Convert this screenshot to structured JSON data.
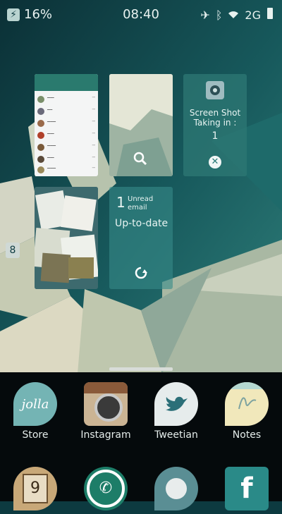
{
  "status_bar": {
    "battery": "16%",
    "time": "08:40",
    "network": "2G"
  },
  "covers": {
    "screenshot": {
      "app_name": "Screen Shot",
      "subtitle": "Taking in :",
      "countdown": "1"
    },
    "email": {
      "count": "1",
      "unread_label": "Unread email",
      "status": "Up-to-date"
    }
  },
  "apps": [
    {
      "label": "Store"
    },
    {
      "label": "Instagram"
    },
    {
      "label": "Tweetian"
    },
    {
      "label": "Notes"
    },
    {
      "label": ""
    },
    {
      "label": ""
    },
    {
      "label": ""
    },
    {
      "label": ""
    }
  ],
  "colors": {
    "accent": "#2a8a88",
    "launcher_bg": "#050a0c",
    "wallpaper_dark": "#0d3a40"
  }
}
